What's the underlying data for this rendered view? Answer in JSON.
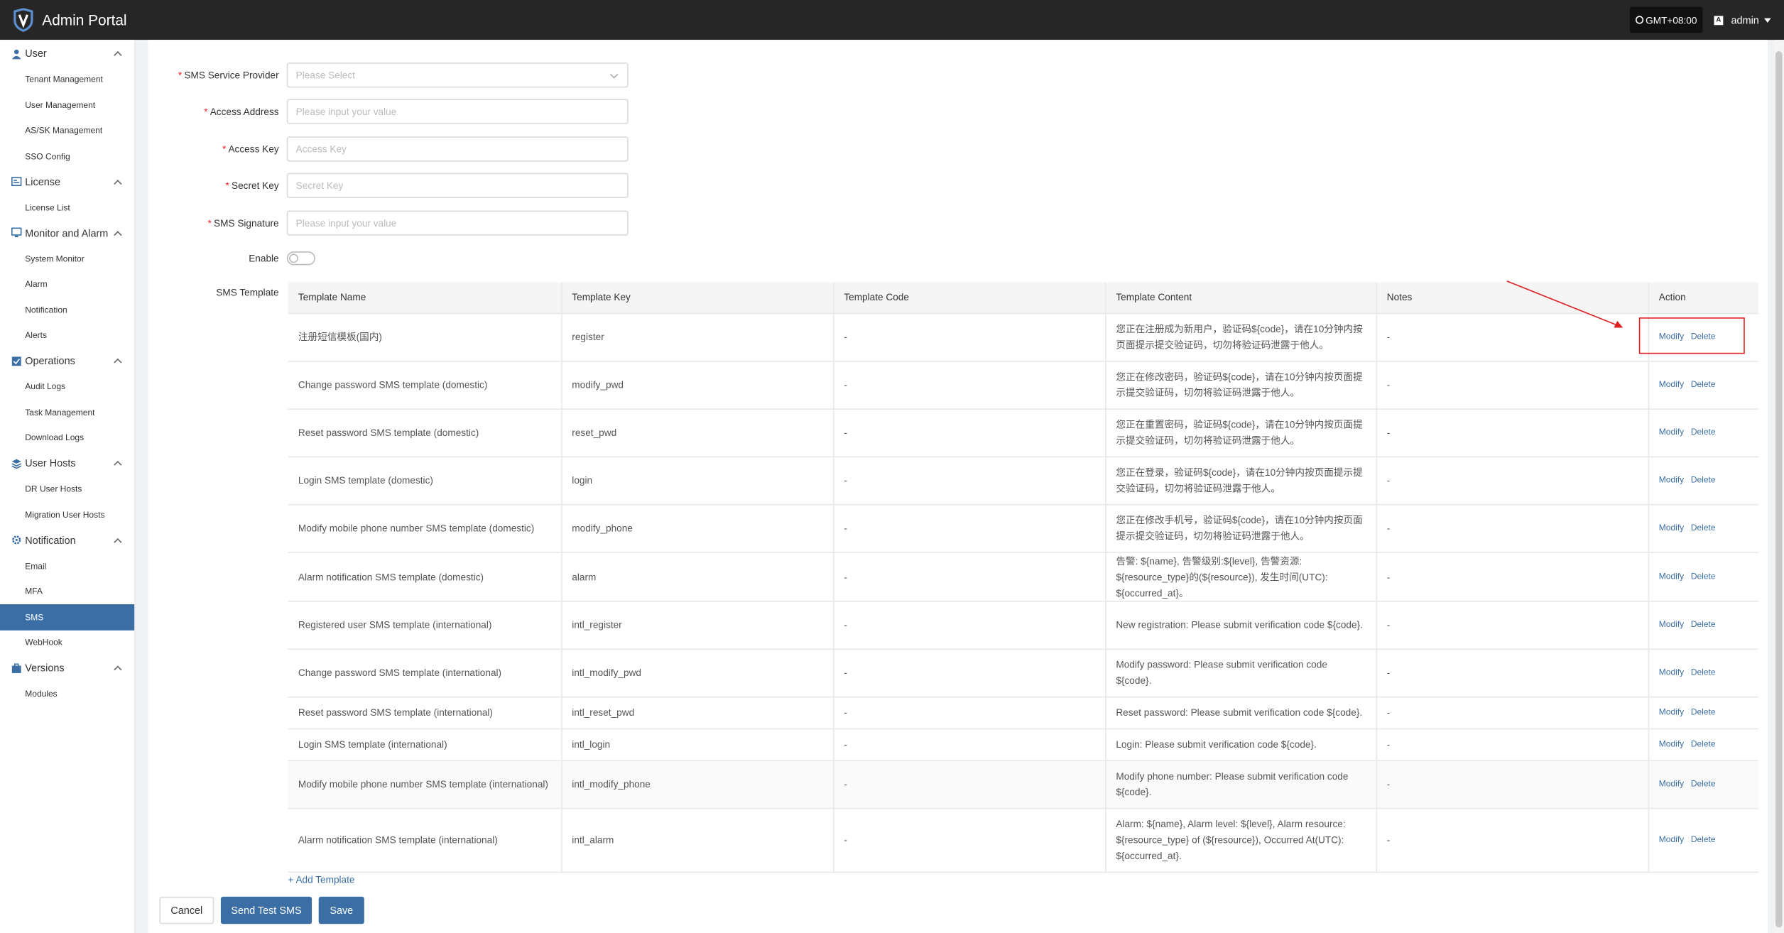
{
  "header": {
    "app_title": "Admin Portal",
    "timezone": "GMT+08:00",
    "user": "admin",
    "user_avatar": "A"
  },
  "sidebar": {
    "groups": [
      {
        "label": "User",
        "icon": "user-icon",
        "items": [
          "Tenant Management",
          "User Management",
          "AS/SK Management",
          "SSO Config"
        ]
      },
      {
        "label": "License",
        "icon": "license-icon",
        "items": [
          "License List"
        ]
      },
      {
        "label": "Monitor and Alarm",
        "icon": "monitor-icon",
        "items": [
          "System Monitor",
          "Alarm",
          "Notification",
          "Alerts"
        ]
      },
      {
        "label": "Operations",
        "icon": "operations-icon",
        "items": [
          "Audit Logs",
          "Task Management",
          "Download Logs"
        ]
      },
      {
        "label": "User Hosts",
        "icon": "hosts-icon",
        "items": [
          "DR User Hosts",
          "Migration User Hosts"
        ]
      },
      {
        "label": "Notification",
        "icon": "gear-icon",
        "items": [
          "Email",
          "MFA",
          "SMS",
          "WebHook"
        ]
      },
      {
        "label": "Versions",
        "icon": "versions-icon",
        "items": [
          "Modules"
        ]
      }
    ],
    "active_item": "SMS"
  },
  "form": {
    "service_provider": {
      "label": "SMS Service Provider",
      "placeholder": "Please Select"
    },
    "access_address": {
      "label": "Access Address",
      "placeholder": "Please input your value"
    },
    "access_key": {
      "label": "Access Key",
      "placeholder": "Access Key"
    },
    "secret_key": {
      "label": "Secret Key",
      "placeholder": "Secret Key"
    },
    "sms_signature": {
      "label": "SMS Signature",
      "placeholder": "Please input your value"
    },
    "enable": {
      "label": "Enable",
      "value": false
    },
    "template_label": "SMS Template"
  },
  "table": {
    "columns": [
      "Template Name",
      "Template Key",
      "Template Code",
      "Template Content",
      "Notes",
      "Action"
    ],
    "rows": [
      {
        "name": "注册短信模板(国内)",
        "key": "register",
        "code": "-",
        "content": "您正在注册成为新用户，验证码${code}，请在10分钟内按页面提示提交验证码，切勿将验证码泄露于他人。",
        "notes": "-"
      },
      {
        "name": "Change password SMS template (domestic)",
        "key": "modify_pwd",
        "code": "-",
        "content": "您正在修改密码，验证码${code}，请在10分钟内按页面提示提交验证码，切勿将验证码泄露于他人。",
        "notes": "-"
      },
      {
        "name": "Reset password SMS template (domestic)",
        "key": "reset_pwd",
        "code": "-",
        "content": "您正在重置密码，验证码${code}，请在10分钟内按页面提示提交验证码，切勿将验证码泄露于他人。",
        "notes": "-"
      },
      {
        "name": "Login SMS template (domestic)",
        "key": "login",
        "code": "-",
        "content": "您正在登录，验证码${code}，请在10分钟内按页面提示提交验证码，切勿将验证码泄露于他人。",
        "notes": "-"
      },
      {
        "name": "Modify mobile phone number SMS template (domestic)",
        "key": "modify_phone",
        "code": "-",
        "content": "您正在修改手机号，验证码${code}，请在10分钟内按页面提示提交验证码，切勿将验证码泄露于他人。",
        "notes": "-"
      },
      {
        "name": "Alarm notification SMS template (domestic)",
        "key": "alarm",
        "code": "-",
        "content": "告警: ${name}, 告警级别:${level}, 告警资源: ${resource_type}的(${resource}), 发生时间(UTC): ${occurred_at}。",
        "notes": "-"
      },
      {
        "name": "Registered user SMS template (international)",
        "key": "intl_register",
        "code": "-",
        "content": "New registration: Please submit verification code ${code}.",
        "notes": "-"
      },
      {
        "name": "Change password SMS template (international)",
        "key": "intl_modify_pwd",
        "code": "-",
        "content": "Modify password: Please submit verification code ${code}.",
        "notes": "-"
      },
      {
        "name": "Reset password SMS template (international)",
        "key": "intl_reset_pwd",
        "code": "-",
        "content": "Reset password: Please submit verification code ${code}.",
        "notes": "-"
      },
      {
        "name": "Login SMS template (international)",
        "key": "intl_login",
        "code": "-",
        "content": "Login: Please submit verification code ${code}.",
        "notes": "-"
      },
      {
        "name": "Modify mobile phone number SMS template (international)",
        "key": "intl_modify_phone",
        "code": "-",
        "content": "Modify phone number: Please submit verification code ${code}.",
        "notes": "-"
      },
      {
        "name": "Alarm notification SMS template (international)",
        "key": "intl_alarm",
        "code": "-",
        "content": "Alarm: ${name}, Alarm level: ${level}, Alarm resource: ${resource_type} of (${resource}), Occurred At(UTC): ${occurred_at}.",
        "notes": "-"
      }
    ],
    "modify_label": "Modify",
    "delete_label": "Delete"
  },
  "add_template": "+ Add Template",
  "buttons": {
    "cancel": "Cancel",
    "send_test": "Send Test SMS",
    "save": "Save"
  },
  "colors": {
    "accent": "#3a6ea5",
    "header_bg": "#262626",
    "annotation": "#e02020"
  }
}
